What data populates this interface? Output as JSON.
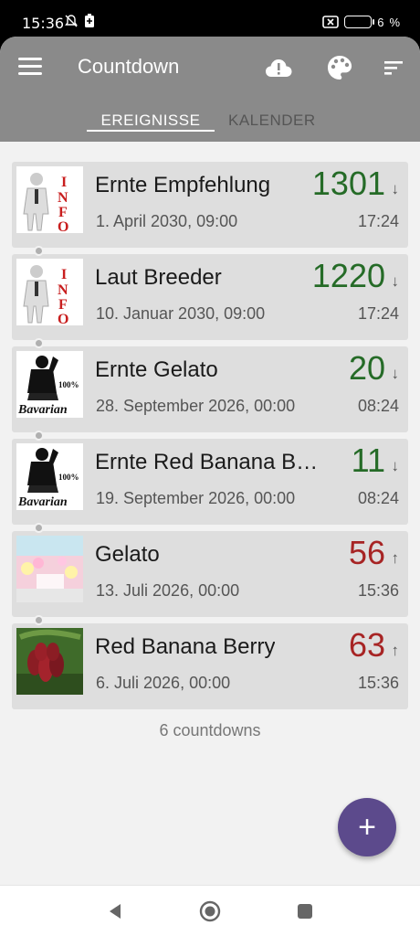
{
  "status_bar": {
    "time": "15:36",
    "battery": "6"
  },
  "app_bar": {
    "title": "Countdown"
  },
  "tabs": [
    {
      "label": "EREIGNISSE",
      "active": true
    },
    {
      "label": "KALENDER",
      "active": false
    }
  ],
  "events": [
    {
      "name": "Ernte Empfehlung",
      "date": "1. April 2030, 09:00",
      "count": "1301",
      "direction": "↓",
      "time": "17:24",
      "color": "#256b27",
      "image": "info-icon"
    },
    {
      "name": "Laut Breeder",
      "date": "10. Januar 2030, 09:00",
      "count": "1220",
      "direction": "↓",
      "time": "17:24",
      "color": "#256b27",
      "image": "info-icon"
    },
    {
      "name": "Ernte Gelato",
      "date": "28. September 2026, 00:00",
      "count": "20",
      "direction": "↓",
      "time": "08:24",
      "color": "#256b27",
      "image": "bavarian-logo"
    },
    {
      "name": "Ernte Red Banana Berry",
      "date": "19. September 2026, 00:00",
      "count": "11",
      "direction": "↓",
      "time": "08:24",
      "color": "#256b27",
      "image": "bavarian-logo"
    },
    {
      "name": "Gelato",
      "date": "13. Juli 2026, 00:00",
      "count": "56",
      "direction": "↑",
      "time": "15:36",
      "color": "#a72424",
      "image": "gelato-pack"
    },
    {
      "name": "Red Banana Berry",
      "date": "6. Juli 2026, 00:00",
      "count": "63",
      "direction": "↑",
      "time": "15:36",
      "color": "#a72424",
      "image": "red-banana-photo"
    }
  ],
  "summary": "6 countdowns",
  "fab": {
    "label": "+"
  },
  "colors": {
    "app_bar": "#8a8a8a",
    "fab": "#5c4a8c",
    "future": "#256b27",
    "past": "#a72424"
  }
}
